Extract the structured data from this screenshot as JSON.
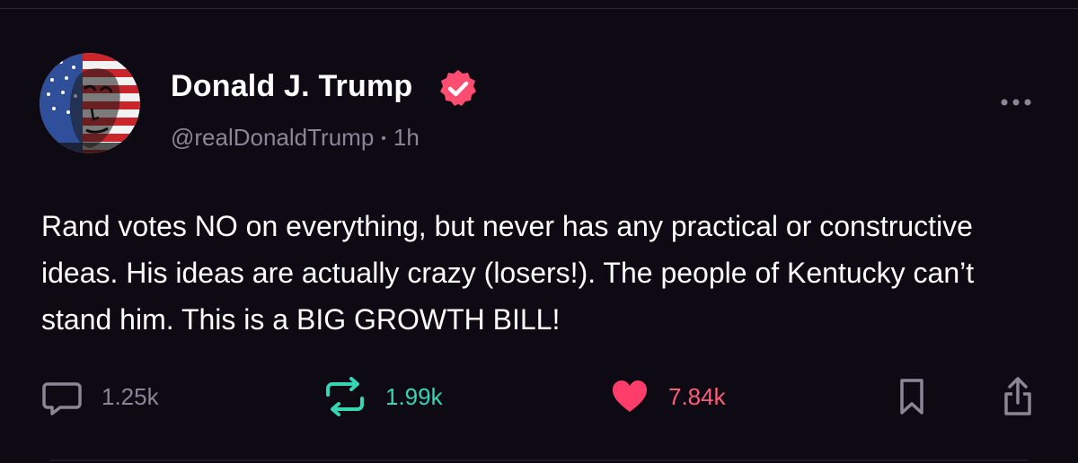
{
  "post": {
    "author": {
      "display_name": "Donald J. Trump",
      "handle": "@realDonaldTrump",
      "verified": true,
      "avatar_icon": "profile-avatar"
    },
    "time_ago": "1h",
    "separator": "•",
    "text": "Rand votes NO on everything, but never has any practical or constructive ideas. His ideas are actually crazy (losers!). The people of Kentucky can’t stand him. This is a BIG GROWTH BILL!",
    "actions": {
      "reply": {
        "icon": "comment-icon",
        "count": "1.25k"
      },
      "repost": {
        "icon": "repost-icon",
        "count": "1.99k"
      },
      "like": {
        "icon": "heart-icon",
        "count": "7.84k"
      },
      "bookmark": {
        "icon": "bookmark-icon"
      },
      "share": {
        "icon": "share-icon"
      }
    },
    "more_icon": "more-options-icon"
  },
  "colors": {
    "background": "#0d0a14",
    "verified_badge": "#ff4d72",
    "repost_active": "#35d6b4",
    "like_active": "#ff3d6a",
    "muted_text": "#8a8794"
  }
}
